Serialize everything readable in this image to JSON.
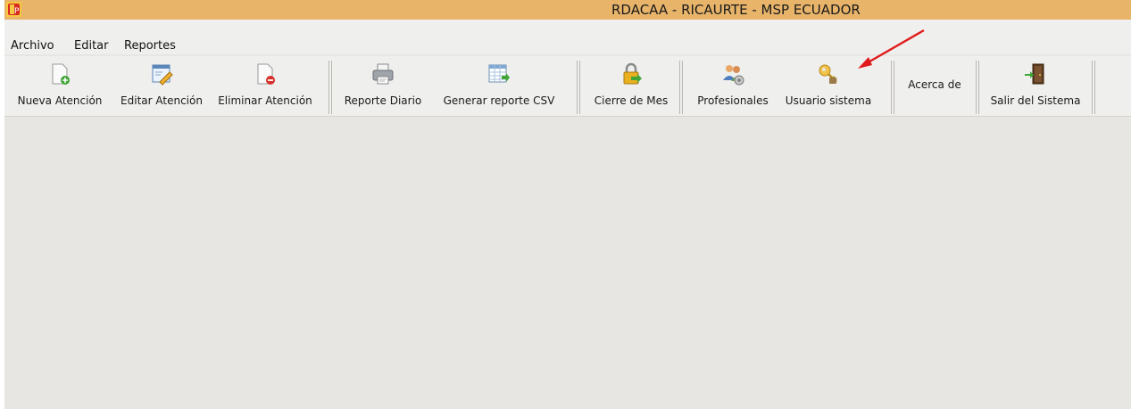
{
  "window": {
    "title": "RDACAA - RICAURTE - MSP ECUADOR"
  },
  "menu": {
    "items": [
      "Archivo",
      "Editar",
      "Reportes"
    ]
  },
  "toolbar": {
    "buttons": [
      {
        "label": "Nueva Atención",
        "icon": "new-document-icon"
      },
      {
        "label": "Editar Atención",
        "icon": "edit-document-icon"
      },
      {
        "label": "Eliminar Atención",
        "icon": "delete-document-icon"
      },
      {
        "label": "Reporte Diario",
        "icon": "printer-icon"
      },
      {
        "label": "Generar reporte CSV",
        "icon": "spreadsheet-export-icon"
      },
      {
        "label": "Cierre de Mes",
        "icon": "lock-icon"
      },
      {
        "label": "Profesionales",
        "icon": "users-settings-icon"
      },
      {
        "label": "Usuario sistema",
        "icon": "key-user-icon"
      },
      {
        "label": "Acerca de",
        "icon": ""
      },
      {
        "label": "Salir del Sistema",
        "icon": "exit-door-icon"
      }
    ]
  },
  "colors": {
    "titlebar": "#e8b46a",
    "background": "#e8e6e2",
    "annotation_arrow": "#e01b1b"
  }
}
